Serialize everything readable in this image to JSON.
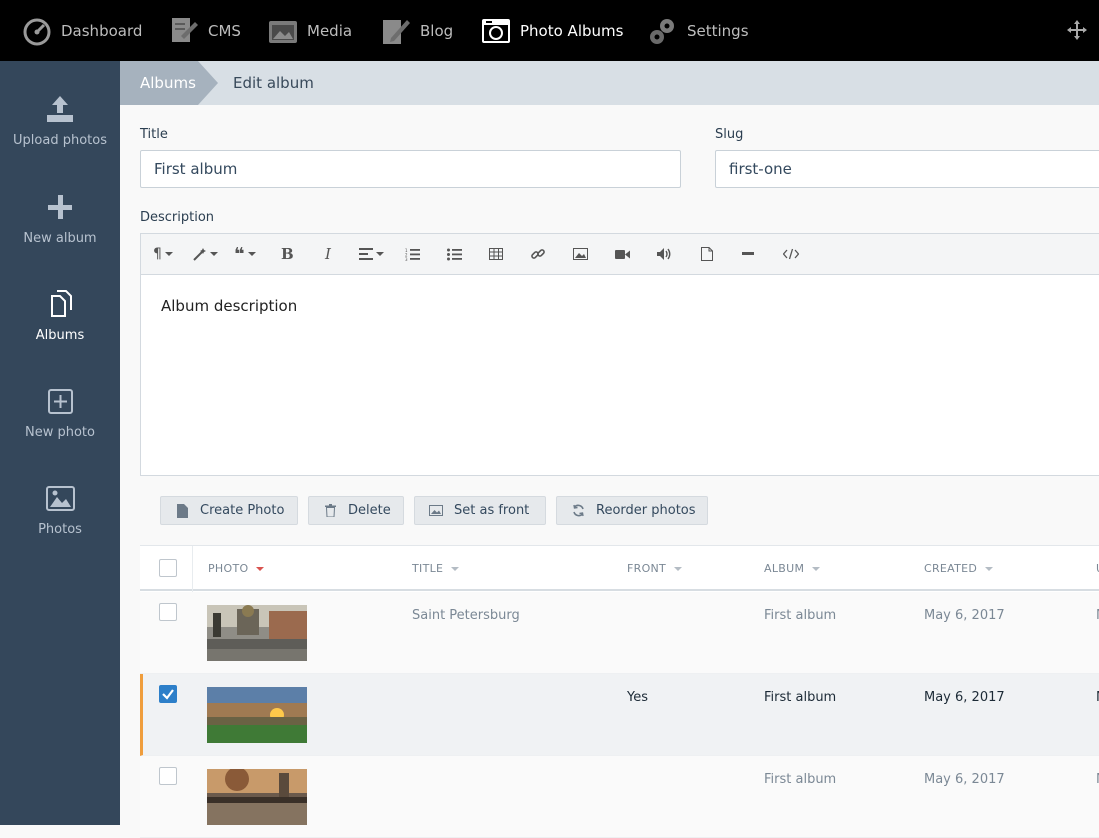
{
  "nav": {
    "items": [
      {
        "label": "Dashboard",
        "icon": "dashboard-gauge-icon"
      },
      {
        "label": "CMS",
        "icon": "cms-doc-icon"
      },
      {
        "label": "Media",
        "icon": "media-camera-icon"
      },
      {
        "label": "Blog",
        "icon": "blog-pencil-icon"
      },
      {
        "label": "Photo Albums",
        "icon": "photo-albums-icon"
      },
      {
        "label": "Settings",
        "icon": "settings-gears-icon"
      }
    ],
    "active": "Photo Albums"
  },
  "sidebar": {
    "items": [
      {
        "label": "Upload photos",
        "icon": "upload-icon"
      },
      {
        "label": "New album",
        "icon": "plus-icon"
      },
      {
        "label": "Albums",
        "icon": "albums-icon"
      },
      {
        "label": "New photo",
        "icon": "plus-square-icon"
      },
      {
        "label": "Photos",
        "icon": "image-icon"
      }
    ],
    "active": "Albums"
  },
  "breadcrumb": {
    "parent": "Albums",
    "current": "Edit album"
  },
  "form": {
    "title_label": "Title",
    "title_value": "First album",
    "slug_label": "Slug",
    "slug_value": "first-one",
    "description_label": "Description",
    "description_value": "Album description"
  },
  "actions": {
    "create": "Create Photo",
    "delete": "Delete",
    "set_front": "Set as front",
    "reorder": "Reorder photos"
  },
  "table": {
    "columns": [
      "PHOTO",
      "TITLE",
      "FRONT",
      "ALBUM",
      "CREATED",
      "U"
    ],
    "rows": [
      {
        "title": "Saint Petersburg",
        "front": "",
        "album": "First album",
        "created": "May 6, 2017",
        "updated": "M",
        "checked": false
      },
      {
        "title": "",
        "front": "Yes",
        "album": "First album",
        "created": "May 6, 2017",
        "updated": "M",
        "checked": true
      },
      {
        "title": "",
        "front": "",
        "album": "First album",
        "created": "May 6, 2017",
        "updated": "M",
        "checked": false
      }
    ]
  },
  "colors": {
    "accent": "#2d7fc9",
    "selected_bar": "#ef9d3c",
    "sidebar": "#34475b"
  }
}
